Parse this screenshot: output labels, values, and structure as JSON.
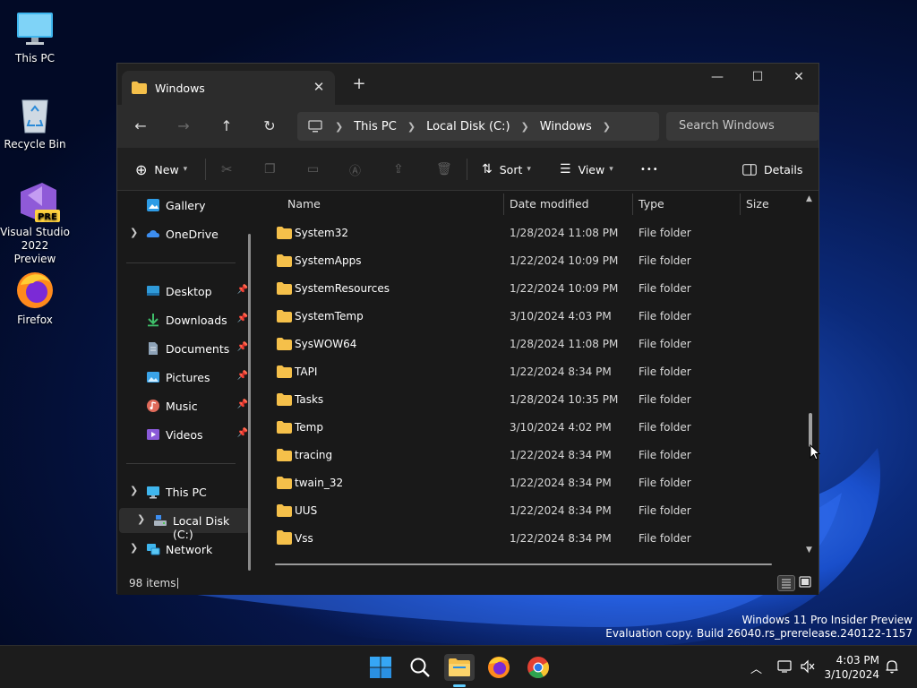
{
  "desktop": {
    "icons": [
      {
        "label": "This PC"
      },
      {
        "label": "Recycle Bin"
      },
      {
        "label_line1": "Visual Studio",
        "label_line2": "2022 Preview",
        "badge": "PRE"
      },
      {
        "label": "Firefox"
      }
    ]
  },
  "window": {
    "tab_title": "Windows",
    "tab_close": "✕",
    "new_tab": "+",
    "controls": {
      "minimize": "—",
      "maximize": "☐",
      "close": "✕"
    },
    "breadcrumbs": [
      "This PC",
      "Local Disk (C:)",
      "Windows"
    ],
    "search_placeholder": "Search Windows",
    "toolbar": {
      "new_label": "New",
      "sort_label": "Sort",
      "view_label": "View",
      "more_label": "•••",
      "details_label": "Details"
    },
    "nav_pane": {
      "quick": [
        {
          "label": "Gallery"
        },
        {
          "label": "OneDrive"
        }
      ],
      "pinned": [
        {
          "label": "Desktop"
        },
        {
          "label": "Downloads"
        },
        {
          "label": "Documents"
        },
        {
          "label": "Pictures"
        },
        {
          "label": "Music"
        },
        {
          "label": "Videos"
        }
      ],
      "drives": [
        {
          "label": "This PC"
        },
        {
          "label": "Local Disk (C:)"
        },
        {
          "label": "Network"
        }
      ]
    },
    "columns": {
      "name": "Name",
      "date": "Date modified",
      "type": "Type",
      "size": "Size"
    },
    "files": [
      {
        "name": "System32",
        "date": "1/28/2024 11:08 PM",
        "type": "File folder"
      },
      {
        "name": "SystemApps",
        "date": "1/22/2024 10:09 PM",
        "type": "File folder"
      },
      {
        "name": "SystemResources",
        "date": "1/22/2024 10:09 PM",
        "type": "File folder"
      },
      {
        "name": "SystemTemp",
        "date": "3/10/2024 4:03 PM",
        "type": "File folder"
      },
      {
        "name": "SysWOW64",
        "date": "1/28/2024 11:08 PM",
        "type": "File folder"
      },
      {
        "name": "TAPI",
        "date": "1/22/2024 8:34 PM",
        "type": "File folder"
      },
      {
        "name": "Tasks",
        "date": "1/28/2024 10:35 PM",
        "type": "File folder"
      },
      {
        "name": "Temp",
        "date": "3/10/2024 4:02 PM",
        "type": "File folder"
      },
      {
        "name": "tracing",
        "date": "1/22/2024 8:34 PM",
        "type": "File folder"
      },
      {
        "name": "twain_32",
        "date": "1/22/2024 8:34 PM",
        "type": "File folder"
      },
      {
        "name": "UUS",
        "date": "1/22/2024 8:34 PM",
        "type": "File folder"
      },
      {
        "name": "Vss",
        "date": "1/22/2024 8:34 PM",
        "type": "File folder"
      }
    ],
    "status": {
      "item_count": "98 items"
    }
  },
  "watermark": {
    "line1": "Windows 11 Pro Insider Preview",
    "line2": "Evaluation copy. Build 26040.rs_prerelease.240122-1157"
  },
  "taskbar": {
    "time": "4:03 PM",
    "date": "3/10/2024"
  },
  "colors": {
    "accent": "#60cdff",
    "folder": "#f5c04a",
    "window_bg": "#191919"
  }
}
